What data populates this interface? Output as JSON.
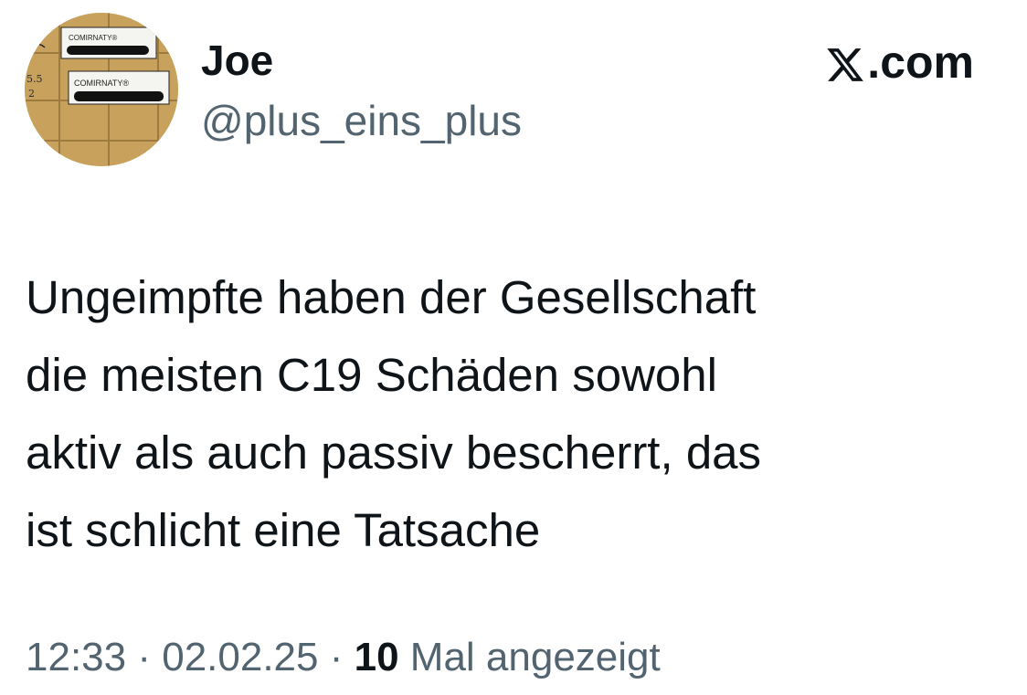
{
  "author": {
    "display_name": "Joe",
    "handle": "@plus_eins_plus",
    "avatar": {
      "icon": "avatar-photo",
      "label_top": "COMIRNATY®",
      "label_bottom": "COMIRNATY®",
      "scribble_top": "5.5",
      "scribble_bottom": "2"
    }
  },
  "brand": {
    "icon": "x-logo-icon",
    "domain_text": ".com"
  },
  "tweet": {
    "text": "Ungeimpfte haben der Gesellschaft\ndie meisten C19 Schäden sowohl\naktiv als auch passiv bescherrt, das\nist schlicht eine Tatsache"
  },
  "meta": {
    "time": "12:33",
    "separator_1": " · ",
    "date": "02.02.25",
    "separator_2": " · ",
    "views_count": "10",
    "views_label": " Mal angezeigt"
  },
  "colors": {
    "text_primary": "#0f1419",
    "text_secondary": "#536471",
    "background": "#ffffff"
  }
}
